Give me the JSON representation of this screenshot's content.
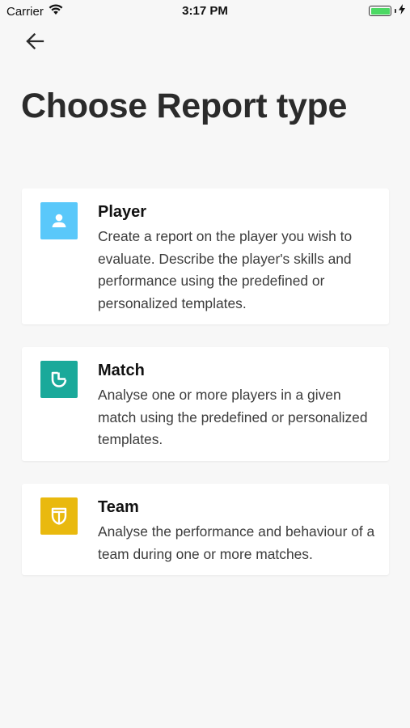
{
  "status_bar": {
    "carrier": "Carrier",
    "time": "3:17 PM"
  },
  "header": {
    "back_icon": "arrow-left-icon",
    "title": "Choose Report type"
  },
  "cards": [
    {
      "title": "Player",
      "description": "Create a report on the player you wish to evaluate. Describe the player's skills and performance using the predefined or personalized templates.",
      "icon": "person-icon",
      "color": "#5ac8fa"
    },
    {
      "title": "Match",
      "description": "Analyse one or more players in a given match using the predefined or personalized templates.",
      "icon": "match-shield-icon",
      "color": "#1aa99a"
    },
    {
      "title": "Team",
      "description": "Analyse the performance and behaviour of a team during one or more matches.",
      "icon": "team-shield-icon",
      "color": "#e9b90e"
    }
  ],
  "colors": {
    "background": "#f7f7f7",
    "card": "#ffffff",
    "battery": "#4cd964"
  }
}
